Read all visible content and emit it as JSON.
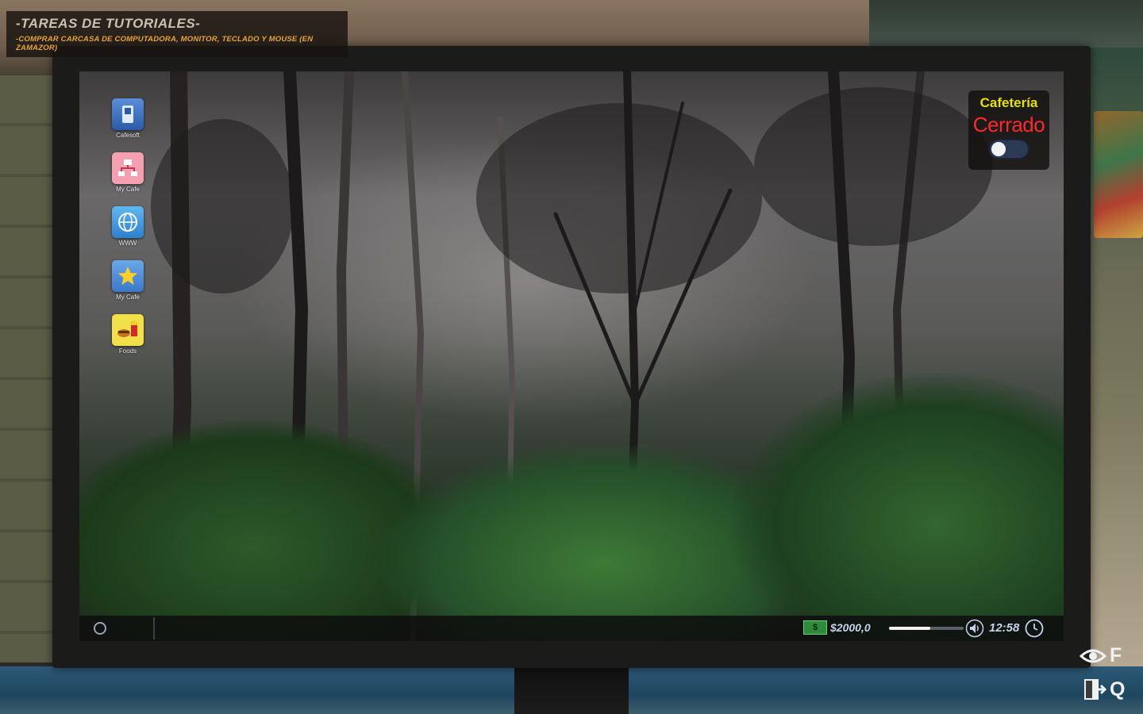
{
  "tutorial": {
    "title": "-TAREAS DE TUTORIALES-",
    "task": "-COMPRAR CARCASA DE COMPUTADORA, MONITOR, TECLADO Y MOUSE (EN ZAMAZOR)"
  },
  "desktop": {
    "icons": [
      {
        "label": "Cafesoft",
        "icon": "cafesoft-icon"
      },
      {
        "label": "My Cafe",
        "icon": "network-icon"
      },
      {
        "label": "WWW",
        "icon": "globe-icon"
      },
      {
        "label": "My Cafe",
        "icon": "star-icon"
      },
      {
        "label": "Foods",
        "icon": "foods-icon"
      }
    ]
  },
  "cafe": {
    "title": "Cafetería",
    "status": "Cerrado",
    "toggle_on": false
  },
  "taskbar": {
    "money_symbol": "$",
    "money": "$2000,0",
    "volume_level": 0.55,
    "time": "12:58"
  },
  "hints": {
    "view_key": "F",
    "exit_key": "Q"
  },
  "colors": {
    "cafe_title": "#e4e000",
    "cafe_status": "#ff2a2a",
    "tutorial_task": "#e6a43a"
  }
}
